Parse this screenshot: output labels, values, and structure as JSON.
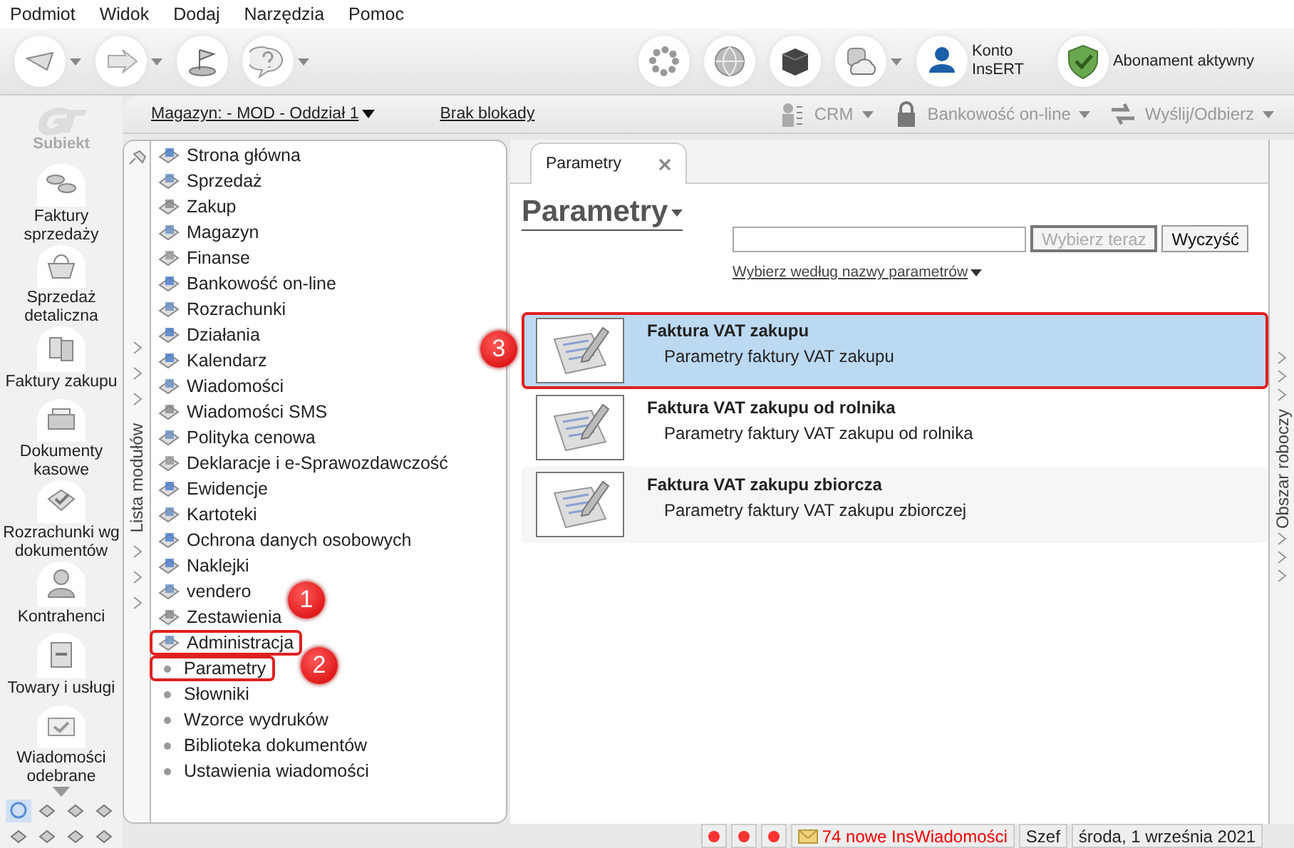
{
  "menu": [
    "Podmiot",
    "Widok",
    "Dodaj",
    "Narzędzia",
    "Pomoc"
  ],
  "toolbar": {
    "account": "Konto InsERT",
    "subscription": "Abonament aktywny"
  },
  "subbar": {
    "warehouse_link": "Magazyn: - MOD - Oddział 1",
    "lock_link": "Brak blokady",
    "actions": [
      {
        "label": "CRM",
        "disabled": true
      },
      {
        "label": "Bankowość on-line",
        "disabled": true
      },
      {
        "label": "Wyślij/Odbierz",
        "disabled": true
      }
    ]
  },
  "sidebar": {
    "logo": "Subiekt",
    "items": [
      "Faktury sprzedaży",
      "Sprzedaż detaliczna",
      "Faktury zakupu",
      "Dokumenty kasowe",
      "Rozrachunki wg dokumentów",
      "Kontrahenci",
      "Towary i usługi",
      "Wiadomości odebrane"
    ],
    "quick_icons": [
      {
        "selected": true
      },
      {
        "selected": false
      },
      {
        "selected": false
      },
      {
        "selected": false
      },
      {
        "selected": false
      },
      {
        "selected": false
      },
      {
        "selected": false
      },
      {
        "selected": false
      }
    ]
  },
  "modules": {
    "title": "Lista modułów",
    "items": [
      {
        "label": "Strona główna",
        "outlined": false
      },
      {
        "label": "Sprzedaż",
        "outlined": false
      },
      {
        "label": "Zakup",
        "outlined": false
      },
      {
        "label": "Magazyn",
        "outlined": false
      },
      {
        "label": "Finanse",
        "outlined": false
      },
      {
        "label": "Bankowość on-line",
        "outlined": false
      },
      {
        "label": "Rozrachunki",
        "outlined": false
      },
      {
        "label": "Działania",
        "outlined": false
      },
      {
        "label": "Kalendarz",
        "outlined": false
      },
      {
        "label": "Wiadomości",
        "outlined": false
      },
      {
        "label": "Wiadomości SMS",
        "outlined": false
      },
      {
        "label": "Polityka cenowa",
        "outlined": false
      },
      {
        "label": "Deklaracje i e-Sprawozdawczość",
        "outlined": false
      },
      {
        "label": "Ewidencje",
        "outlined": false
      },
      {
        "label": "Kartoteki",
        "outlined": false
      },
      {
        "label": "Ochrona danych osobowych",
        "outlined": false
      },
      {
        "label": "Naklejki",
        "outlined": false
      },
      {
        "label": "vendero",
        "outlined": false
      },
      {
        "label": "Zestawienia",
        "outlined": false
      },
      {
        "label": "Administracja",
        "outlined": true,
        "children": [
          {
            "label": "Parametry",
            "outlined": true
          },
          {
            "label": "Słowniki",
            "outlined": false
          },
          {
            "label": "Wzorce wydruków",
            "outlined": false
          },
          {
            "label": "Biblioteka dokumentów",
            "outlined": false
          },
          {
            "label": "Ustawienia wiadomości",
            "outlined": false
          }
        ]
      }
    ]
  },
  "tabs": [
    {
      "label": "Parametry",
      "selected": true
    }
  ],
  "heading": "Parametry",
  "buttons": [
    {
      "label": "Wybierz teraz",
      "disabled": true
    },
    {
      "label": "Wyczyść",
      "disabled": false
    }
  ],
  "filter_link": "Wybierz według nazwy parametrów",
  "results": [
    {
      "title": "Faktura VAT zakupu",
      "subtitle": "Parametry faktury VAT zakupu",
      "selected": true,
      "outlined": true
    },
    {
      "title": "Faktura VAT zakupu od rolnika",
      "subtitle": "Parametry faktury VAT zakupu od rolnika",
      "selected": false,
      "outlined": false
    },
    {
      "title": "Faktura VAT zakupu zbiorcza",
      "subtitle": "Parametry faktury VAT zakupu zbiorczej",
      "selected": false,
      "outlined": false
    }
  ],
  "side_panel": {
    "title": "Obszar roboczy"
  },
  "status_bar": {
    "messages": "74 nowe InsWiadomości",
    "user": "Szef",
    "date": "środa, 1 września 2021"
  },
  "annotations": [
    {
      "label": "1"
    },
    {
      "label": "2"
    },
    {
      "label": "3"
    }
  ]
}
